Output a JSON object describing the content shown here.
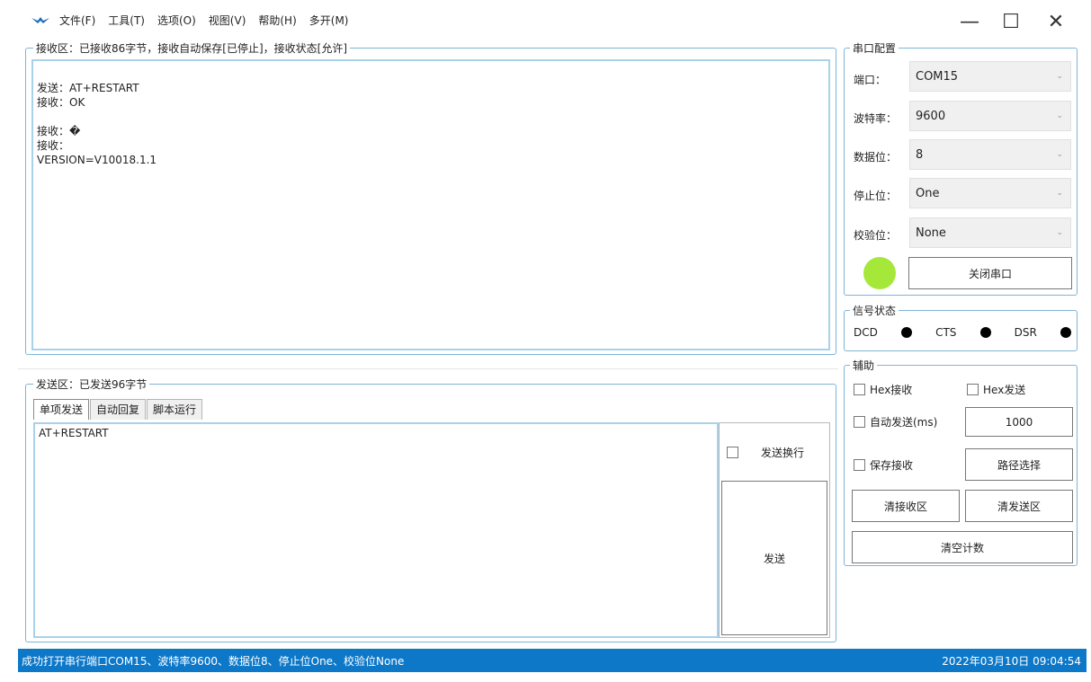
{
  "menu": {
    "items": [
      "文件(F)",
      "工具(T)",
      "选项(O)",
      "视图(V)",
      "帮助(H)",
      "多开(M)"
    ]
  },
  "window_controls": {
    "minimize": "—",
    "maximize": "☐",
    "close": "✕"
  },
  "receive": {
    "legend": "接收区：已接收86字节，接收自动保存[已停止]，接收状态[允许]",
    "content": "\n发送：AT+RESTART\n接收：OK\n\n接收：�\n接收：\nVERSION=V10018.1.1"
  },
  "send": {
    "legend": "发送区：已发送96字节",
    "tabs": [
      "单项发送",
      "自动回复",
      "脚本运行"
    ],
    "content": "AT+RESTART",
    "newline_label": "发送换行",
    "send_button": "发送"
  },
  "port_config": {
    "legend": "串口配置",
    "fields": [
      {
        "label": "端口：",
        "value": "COM15"
      },
      {
        "label": "波特率：",
        "value": "9600"
      },
      {
        "label": "数据位：",
        "value": "8"
      },
      {
        "label": "停止位：",
        "value": "One"
      },
      {
        "label": "校验位：",
        "value": "None"
      }
    ],
    "close_port_button": "关闭串口",
    "indicator_color": "#a5e83a"
  },
  "signal": {
    "legend": "信号状态",
    "items": [
      "DCD",
      "CTS",
      "DSR"
    ]
  },
  "aux": {
    "legend": "辅助",
    "hex_receive": "Hex接收",
    "hex_send": "Hex发送",
    "auto_send": "自动发送(ms)",
    "auto_send_interval": "1000",
    "save_receive": "保存接收",
    "path_button": "路径选择",
    "clear_receive_button": "清接收区",
    "clear_send_button": "清发送区",
    "clear_count_button": "清空计数"
  },
  "status": {
    "message": "成功打开串行端口COM15、波特率9600、数据位8、停止位One、校验位None",
    "datetime": "2022年03月10日 09:04:54",
    "color": "#0e78c8"
  }
}
